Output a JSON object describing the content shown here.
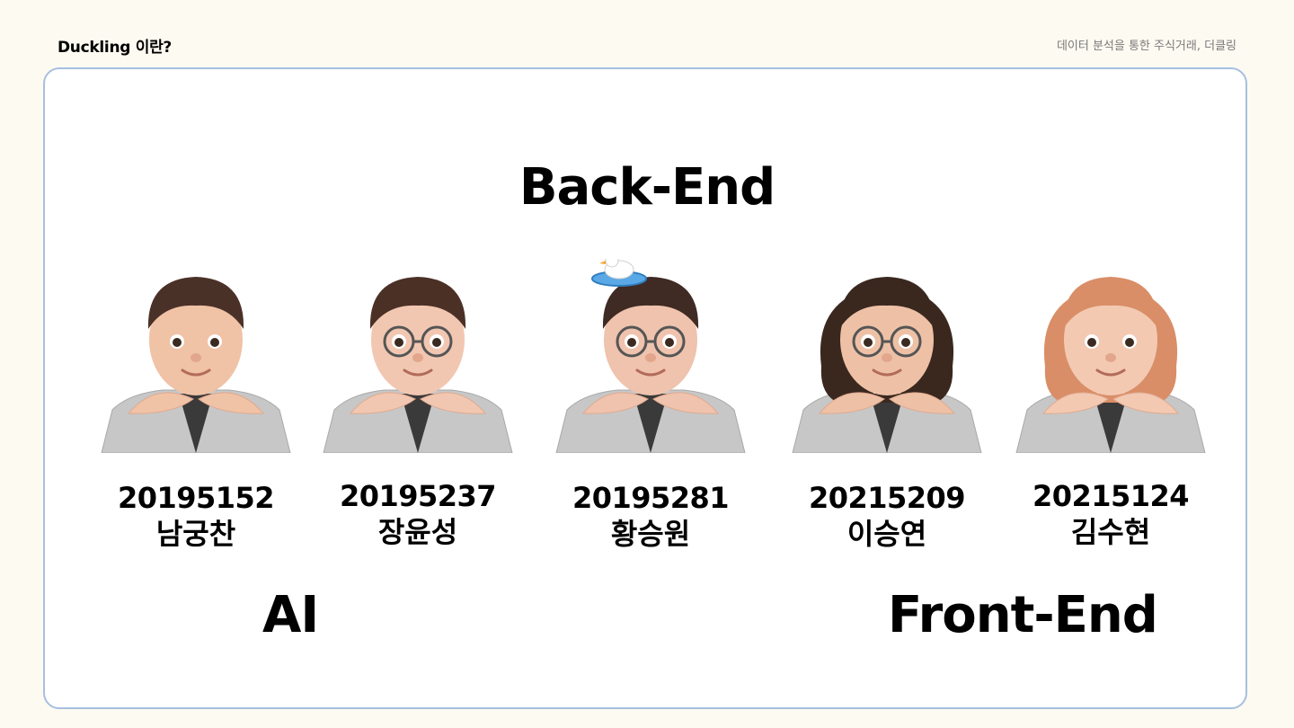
{
  "header": {
    "title": "Duckling 이란?",
    "subtitle": "데이터 분석을 통한 주식거래, 더클링"
  },
  "sections": {
    "backend": "Back-End",
    "ai": "AI",
    "frontend": "Front-End"
  },
  "members": [
    {
      "id": "20195152",
      "name": "남궁찬",
      "avatar": "avatar-icon",
      "hair": "#4a3128",
      "skin": "#f0c2a6",
      "glasses": false,
      "duck": false
    },
    {
      "id": "20195237",
      "name": "장윤성",
      "avatar": "avatar-icon",
      "hair": "#4b3026",
      "skin": "#f2c7b1",
      "glasses": true,
      "duck": false
    },
    {
      "id": "20195281",
      "name": "황승원",
      "avatar": "avatar-icon",
      "hair": "#3f2a24",
      "skin": "#efc3ad",
      "glasses": true,
      "duck": true
    },
    {
      "id": "20215209",
      "name": "이승연",
      "avatar": "avatar-icon",
      "hair": "#3a281f",
      "skin": "#eec1a6",
      "glasses": true,
      "duck": false
    },
    {
      "id": "20215124",
      "name": "김수현",
      "avatar": "avatar-icon",
      "hair": "#d98e67",
      "skin": "#f3c9b2",
      "glasses": false,
      "duck": false
    }
  ]
}
